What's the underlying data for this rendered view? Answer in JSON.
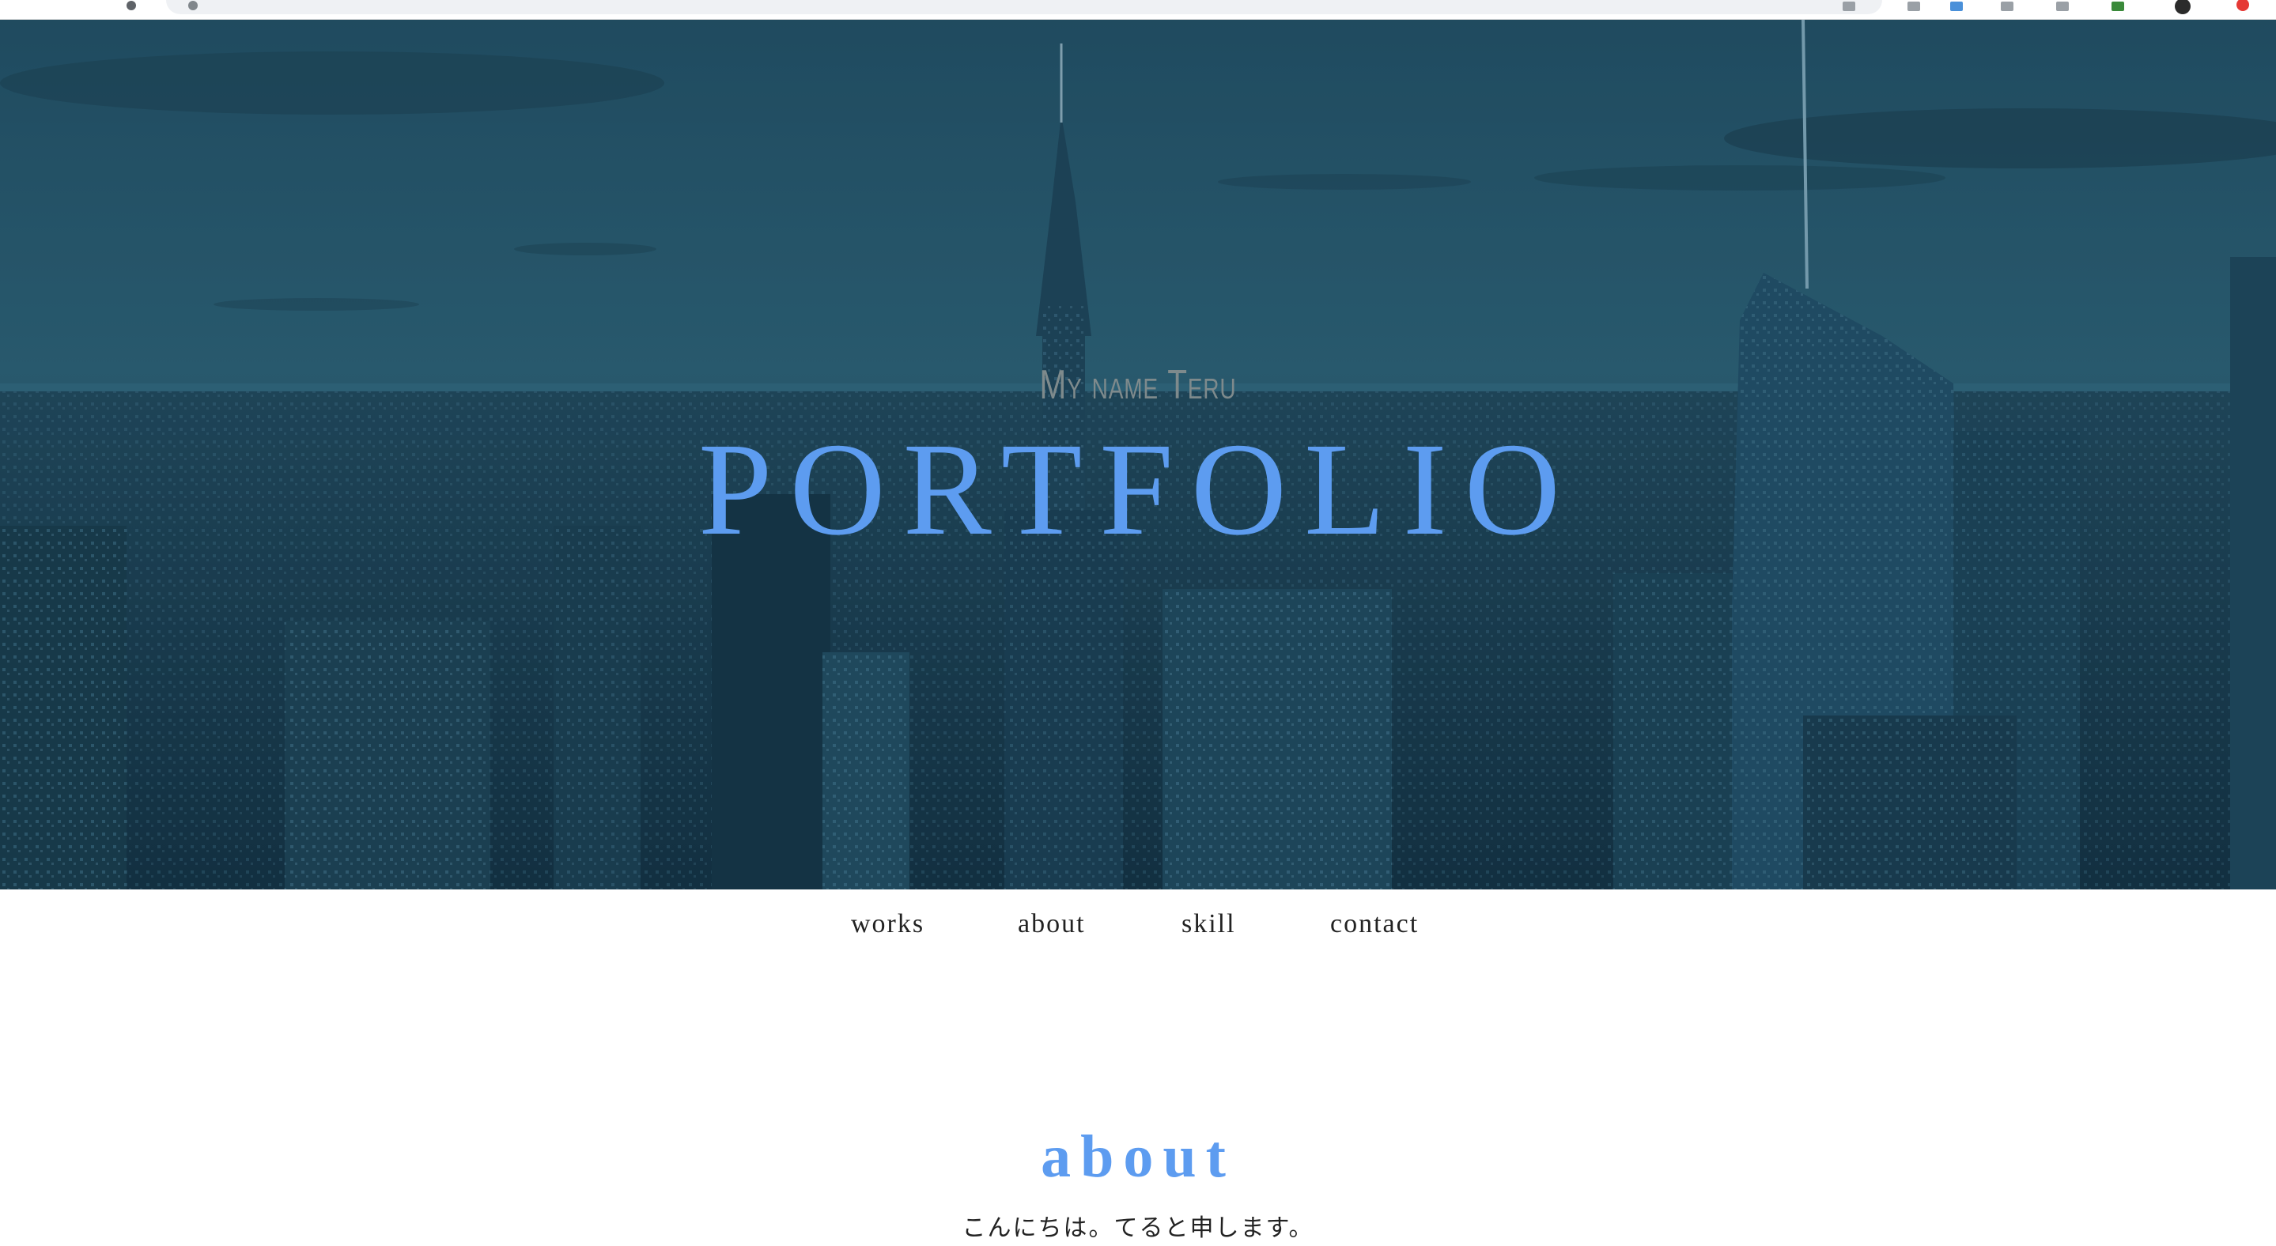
{
  "hero": {
    "subtitle": "My name Teru",
    "title": "PORTFOLIO"
  },
  "nav": {
    "items": [
      {
        "label": "works"
      },
      {
        "label": "about"
      },
      {
        "label": "skill"
      },
      {
        "label": "contact"
      }
    ]
  },
  "about": {
    "title": "about",
    "text": "こんにちは。てると申します。"
  },
  "colors": {
    "accent": "#5d9cf0",
    "hero_overlay": "#1f4a60",
    "nav_text": "#222222"
  }
}
